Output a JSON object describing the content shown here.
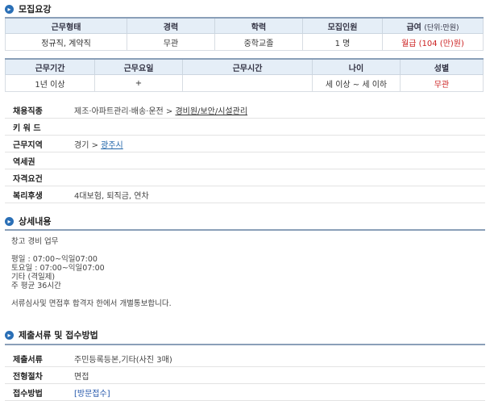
{
  "recruit": {
    "title": "모집요강",
    "table1": {
      "headers": [
        "근무형태",
        "경력",
        "학력",
        "모집인원",
        "급여"
      ],
      "salary_unit": "(단위:만원)",
      "row": [
        "정규직, 계약직",
        "무관",
        "중학교졸",
        "1 명",
        "월급 (104 (만)원)"
      ]
    },
    "table2": {
      "headers": [
        "근무기간",
        "근무요일",
        "근무시간",
        "나이",
        "성별"
      ],
      "row": [
        "1년 이상",
        "+",
        "",
        "세 이상 ~ 세 이하",
        "무관"
      ]
    },
    "info": {
      "job_label": "채용직종",
      "job_prefix": "제조·아파트관리·배송·운전 >",
      "job_link": "경비원/보안/시설관리",
      "keyword_label": "키 워 드",
      "region_label": "근무지역",
      "region_prefix": "경기 >",
      "region_link": "광주시",
      "station_label": "역세권",
      "qual_label": "자격요건",
      "welfare_label": "복리후생",
      "welfare_value": "4대보험, 퇴직금, 연차"
    }
  },
  "detail": {
    "title": "상세내용",
    "lines": [
      "창고 경비 업무",
      "",
      "평일 : 07:00~익일07:00",
      "토요일 : 07:00~익일07:00",
      "기타 (격일제)",
      "주 평균 36시간",
      "",
      "서류심사및 면접후 합격자 한에서 개별통보합니다."
    ]
  },
  "submit": {
    "title": "제출서류 및 접수방법",
    "docs_label": "제출서류",
    "docs_value": "주민등록등본,기타(사진 3매)",
    "process_label": "전형절차",
    "process_value": "면접",
    "method_label": "접수방법",
    "method_value": "[방문접수]"
  }
}
